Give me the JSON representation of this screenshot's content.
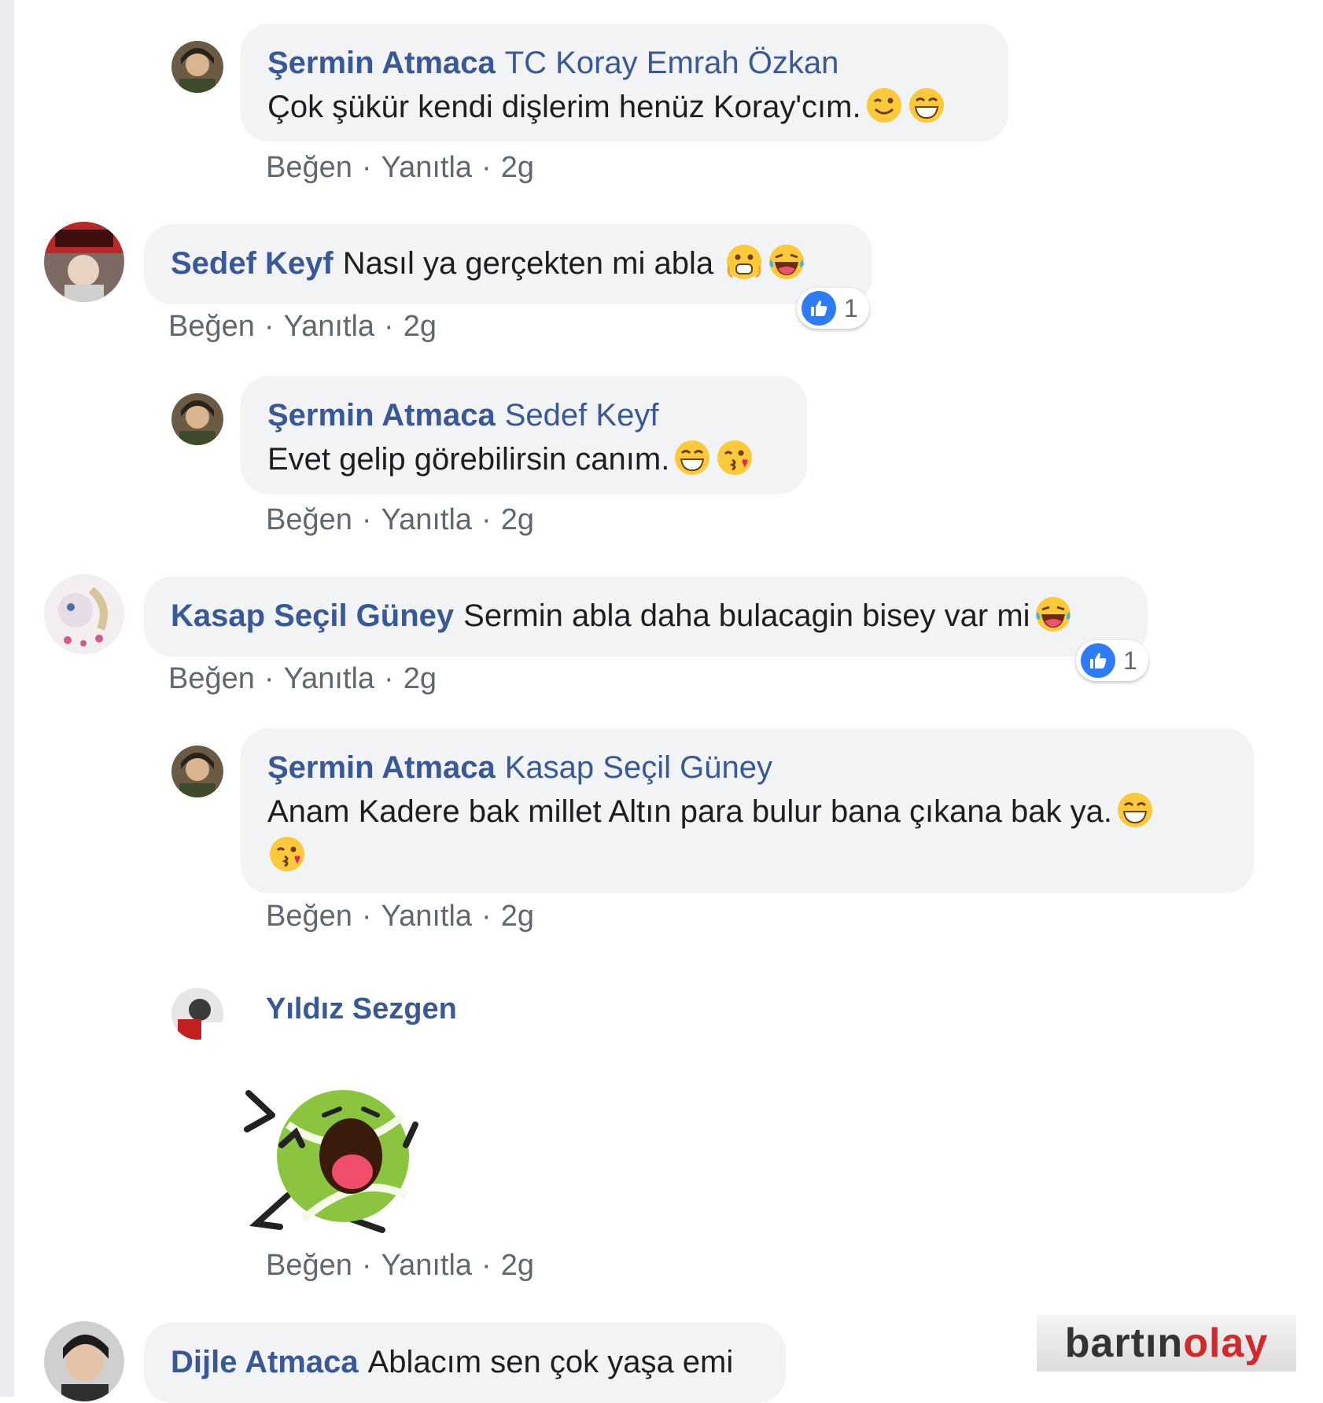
{
  "comments": [
    {
      "author": "Şermin Atmaca",
      "mention": "TC Koray Emrah Özkan",
      "text": "Çok şükür kendi dişlerim henüz Koray'cım.",
      "emojis": [
        "wink-emoji",
        "grin-emoji"
      ],
      "actions": {
        "like": "Beğen",
        "reply": "Yanıtla",
        "time": "2g"
      }
    },
    {
      "author": "Sedef Keyf",
      "text": "Nasıl ya gerçekten mi abla",
      "emojis": [
        "shocked-emoji",
        "laughing-tears-emoji"
      ],
      "reaction_count": "1",
      "actions": {
        "like": "Beğen",
        "reply": "Yanıtla",
        "time": "2g"
      }
    },
    {
      "author": "Şermin Atmaca",
      "mention": "Sedef Keyf",
      "text": "Evet gelip görebilirsin canım.",
      "emojis": [
        "grin-emoji",
        "kiss-emoji"
      ],
      "actions": {
        "like": "Beğen",
        "reply": "Yanıtla",
        "time": "2g"
      }
    },
    {
      "author": "Kasap Seçil Güney",
      "text": "Sermin abla daha bulacagin bisey var mi",
      "emojis": [
        "laughing-tears-emoji"
      ],
      "reaction_count": "1",
      "actions": {
        "like": "Beğen",
        "reply": "Yanıtla",
        "time": "2g"
      }
    },
    {
      "author": "Şermin Atmaca",
      "mention": "Kasap Seçil Güney",
      "text": "Anam Kadere bak millet Altın para bulur bana çıkana bak ya.",
      "emojis": [
        "grin-emoji",
        "kiss-emoji"
      ],
      "actions": {
        "like": "Beğen",
        "reply": "Yanıtla",
        "time": "2g"
      }
    },
    {
      "author": "Yıldız Sezgen",
      "sticker": "laughing-tennis-ball-sticker",
      "actions": {
        "like": "Beğen",
        "reply": "Yanıtla",
        "time": "2g"
      }
    },
    {
      "author": "Dijle Atmaca",
      "text": "Ablacım sen çok yaşa emi"
    }
  ],
  "watermark": {
    "part1": "bartın",
    "part2": "olay"
  },
  "colors": {
    "author": "#385898",
    "bubble": "#f2f3f5",
    "like": "#2e7bf6",
    "meta": "#606770"
  }
}
